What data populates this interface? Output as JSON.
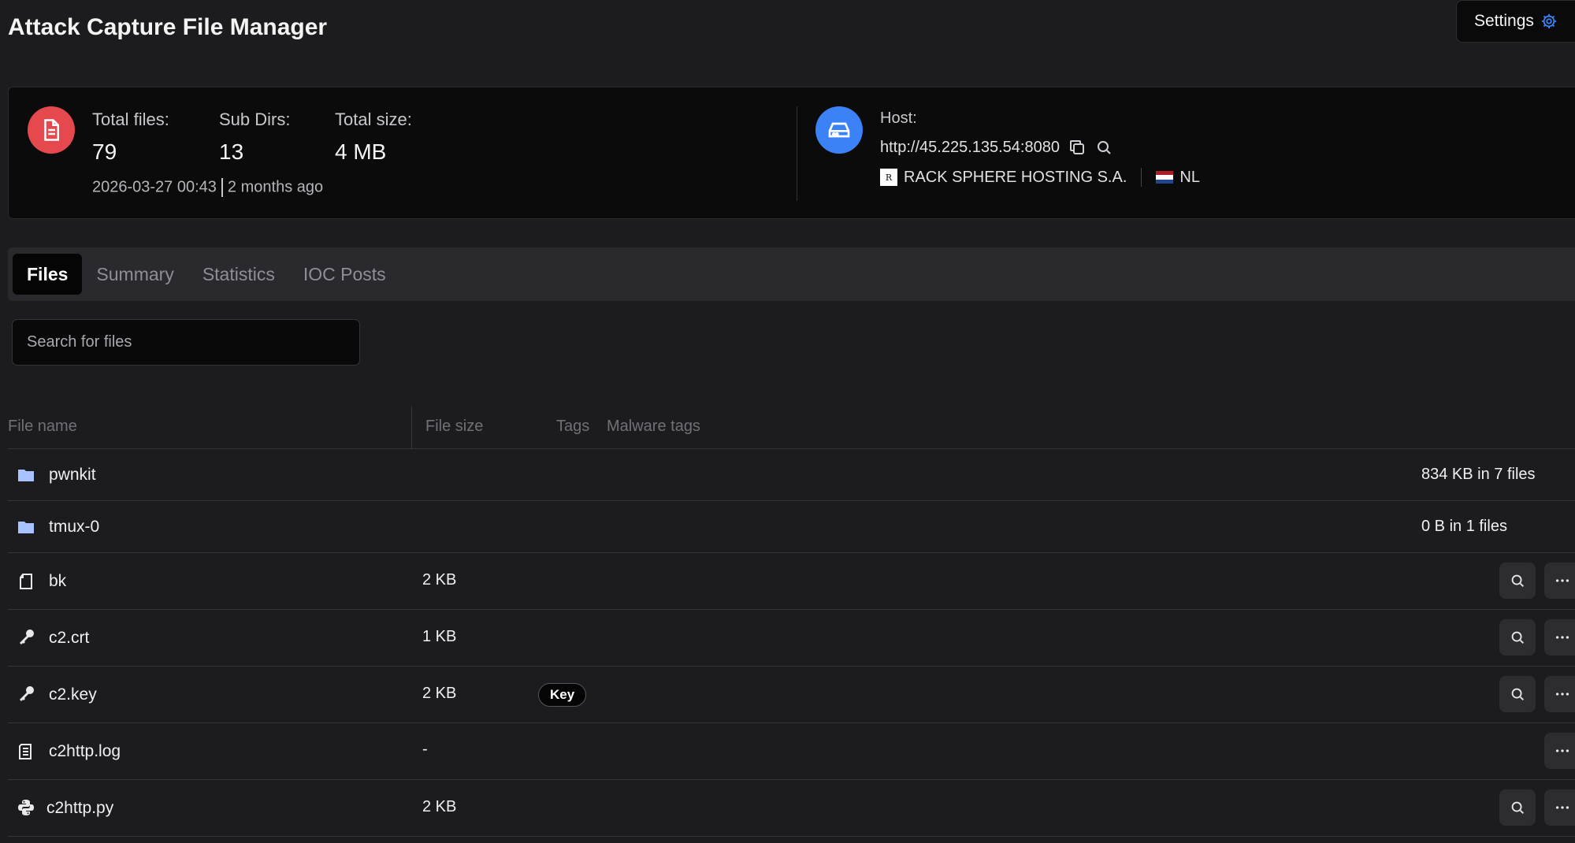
{
  "header": {
    "title": "Attack Capture File Manager",
    "settings_label": "Settings"
  },
  "summary": {
    "total_files_label": "Total files:",
    "total_files": "79",
    "sub_dirs_label": "Sub Dirs:",
    "sub_dirs": "13",
    "total_size_label": "Total size:",
    "total_size": "4 MB",
    "timestamp": "2026-03-27 00:43",
    "relative_time": "2 months ago",
    "host_label": "Host:",
    "host_url": "http://45.225.135.54:8080",
    "org_logo_letter": "R",
    "org_name": "RACK SPHERE HOSTING S.A.",
    "country": "NL"
  },
  "tabs": [
    {
      "label": "Files",
      "active": true
    },
    {
      "label": "Summary",
      "active": false
    },
    {
      "label": "Statistics",
      "active": false
    },
    {
      "label": "IOC Posts",
      "active": false
    }
  ],
  "search": {
    "placeholder": "Search for files"
  },
  "table": {
    "columns": [
      "File name",
      "File size",
      "Tags",
      "Malware tags"
    ],
    "rows": [
      {
        "name": "pwnkit",
        "icon": "folder-icon",
        "size": "",
        "tag": "",
        "count": "834 KB in 7 files"
      },
      {
        "name": "tmux-0",
        "icon": "folder-icon",
        "size": "",
        "tag": "",
        "count": "0 B in 1 files"
      },
      {
        "name": "bk",
        "icon": "file-icon",
        "size": "2 KB",
        "tag": "",
        "count": ""
      },
      {
        "name": "c2.crt",
        "icon": "key-icon",
        "size": "1 KB",
        "tag": "",
        "count": ""
      },
      {
        "name": "c2.key",
        "icon": "key-icon",
        "size": "2 KB",
        "tag": "Key",
        "count": ""
      },
      {
        "name": "c2http.log",
        "icon": "log-file-icon",
        "size": "-",
        "tag": "",
        "count": ""
      },
      {
        "name": "c2http.py",
        "icon": "python-icon",
        "size": "2 KB",
        "tag": "",
        "count": ""
      }
    ]
  },
  "colors": {
    "files_circle": "#e5484d",
    "host_circle": "#3b82f6",
    "folder_icon": "#a8c3ff",
    "settings_gear": "#3b82f6"
  }
}
